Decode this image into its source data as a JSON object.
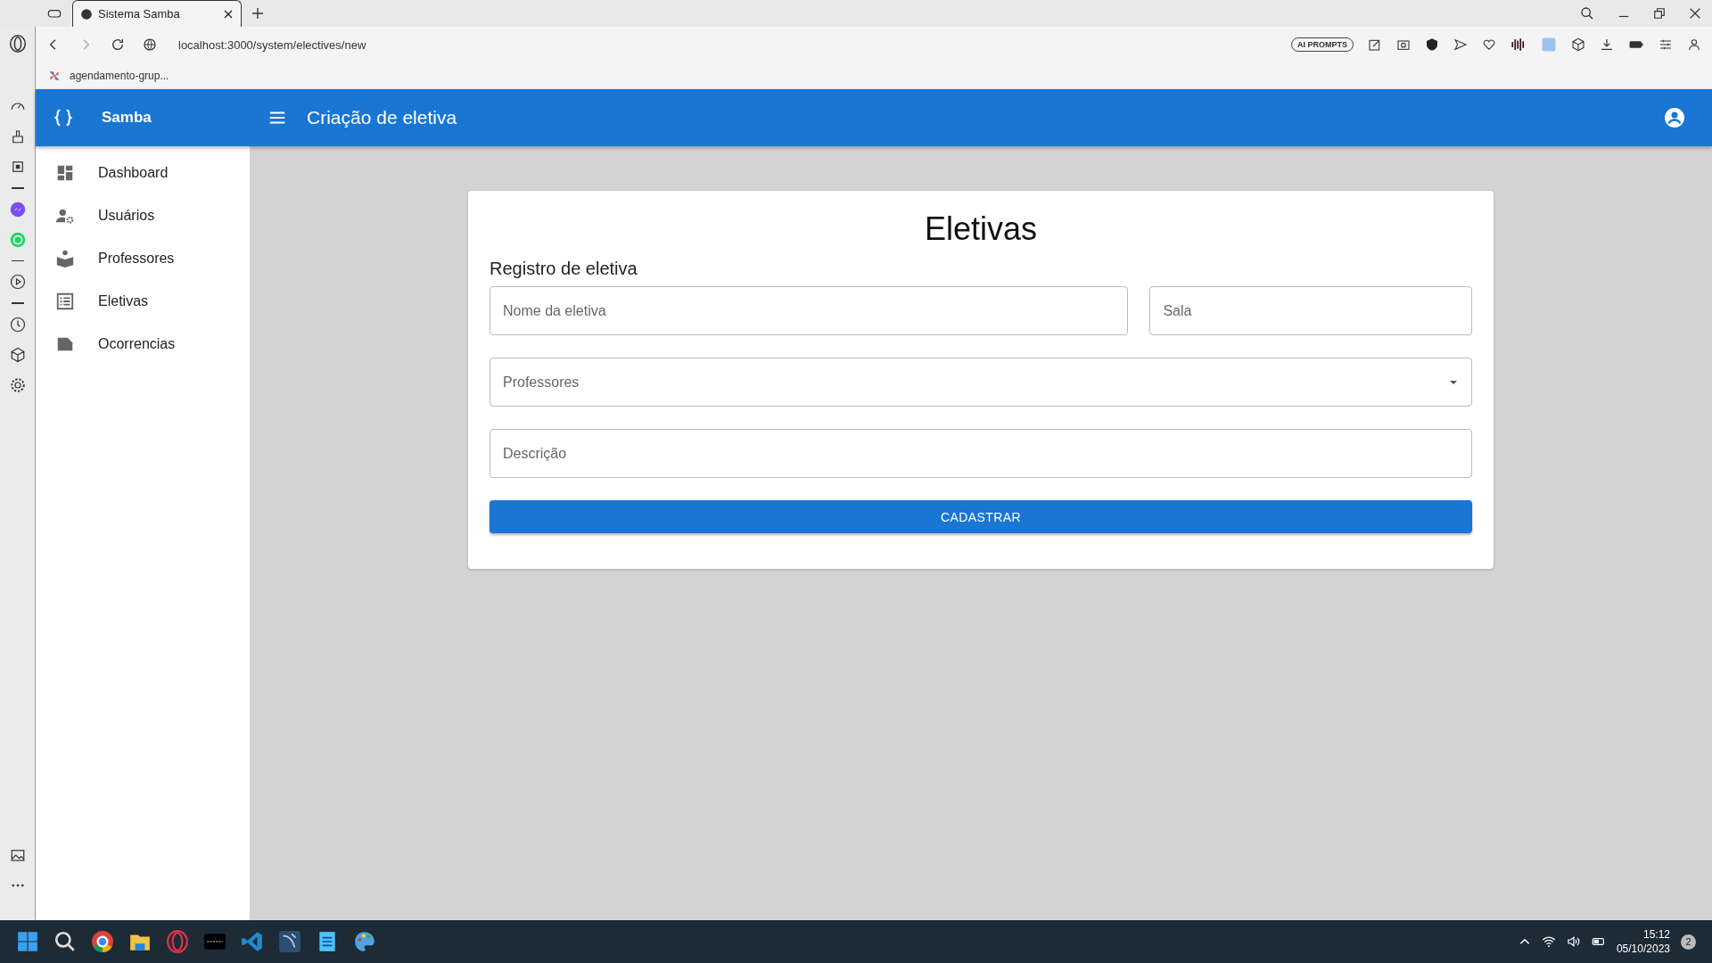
{
  "browser": {
    "tab_title": "Sistema Samba",
    "url": "localhost:3000/system/electives/new",
    "bookmark": "agendamento-grup...",
    "ai_prompts": "AI PROMPTS"
  },
  "app": {
    "brand": "Samba",
    "page_title": "Criação de eletiva"
  },
  "nav": [
    {
      "label": "Dashboard",
      "kind": "dashboard"
    },
    {
      "label": "Usuários",
      "kind": "users"
    },
    {
      "label": "Professores",
      "kind": "teacher"
    },
    {
      "label": "Eletivas",
      "kind": "list"
    },
    {
      "label": "Ocorrencias",
      "kind": "note"
    }
  ],
  "form": {
    "title": "Eletivas",
    "subtitle": "Registro de eletiva",
    "rows": [
      [
        {
          "placeholder": "Nome da eletiva",
          "kind": "text"
        },
        {
          "placeholder": "Sala",
          "kind": "text"
        }
      ],
      [
        {
          "placeholder": "Professores",
          "kind": "select"
        }
      ],
      [
        {
          "placeholder": "Descrição",
          "kind": "text"
        }
      ]
    ],
    "submit": "CADASTRAR"
  },
  "taskbar": {
    "time": "15:12",
    "date": "05/10/2023",
    "notifications": "2"
  }
}
